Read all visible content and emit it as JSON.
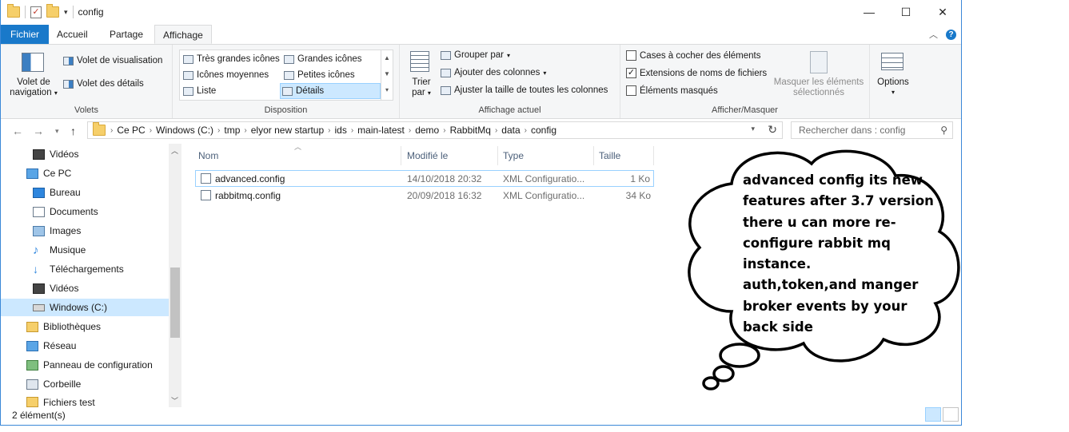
{
  "window": {
    "title": "config"
  },
  "window_controls": {
    "minimize": "—",
    "maximize": "☐",
    "close": "✕"
  },
  "tabs": {
    "file": "Fichier",
    "home": "Accueil",
    "share": "Partage",
    "view": "Affichage"
  },
  "ribbon": {
    "panes": {
      "nav_pane": "Volet de navigation",
      "preview": "Volet de visualisation",
      "details": "Volet des détails",
      "label": "Volets"
    },
    "layout": {
      "xl_icons": "Très grandes icônes",
      "large_icons": "Grandes icônes",
      "medium_icons": "Icônes moyennes",
      "small_icons": "Petites icônes",
      "list": "Liste",
      "details": "Détails",
      "label": "Disposition"
    },
    "current_view": {
      "sort_by": "Trier par",
      "group_by": "Grouper par",
      "add_columns": "Ajouter des colonnes",
      "fit_columns": "Ajuster la taille de toutes les colonnes",
      "label": "Affichage actuel"
    },
    "show_hide": {
      "item_checkboxes": "Cases à cocher des éléments",
      "file_extensions": "Extensions de noms de fichiers",
      "hidden_items": "Éléments masqués",
      "hide_selected": "Masquer les éléments sélectionnés",
      "label": "Afficher/Masquer",
      "file_extensions_checked": true
    },
    "options": "Options"
  },
  "address": {
    "crumbs": [
      "Ce PC",
      "Windows (C:)",
      "tmp",
      "elyor new startup",
      "ids",
      "main-latest",
      "demo",
      "RabbitMq",
      "data",
      "config"
    ],
    "search_placeholder": "Rechercher dans : config"
  },
  "nav_pane": {
    "items": [
      "Vidéos",
      "Ce PC",
      "Bureau",
      "Documents",
      "Images",
      "Musique",
      "Téléchargements",
      "Vidéos",
      "Windows (C:)",
      "Bibliothèques",
      "Réseau",
      "Panneau de configuration",
      "Corbeille",
      "Fichiers test"
    ],
    "selected": "Windows (C:)"
  },
  "file_list": {
    "columns": [
      "Nom",
      "Modifié le",
      "Type",
      "Taille"
    ],
    "rows": [
      {
        "name": "advanced.config",
        "modified": "14/10/2018 20:32",
        "type": "XML Configuratio...",
        "size": "1 Ko"
      },
      {
        "name": "rabbitmq.config",
        "modified": "20/09/2018 16:32",
        "type": "XML Configuratio...",
        "size": "34 Ko"
      }
    ]
  },
  "status_bar": {
    "count": "2 élément(s)"
  },
  "annotation": {
    "lines": [
      "advanced config its new",
      "features after 3.7 version",
      "there u can more re-",
      "configure rabbit mq",
      "instance.",
      "auth,token,and manger",
      "broker events by your",
      "back side"
    ]
  }
}
